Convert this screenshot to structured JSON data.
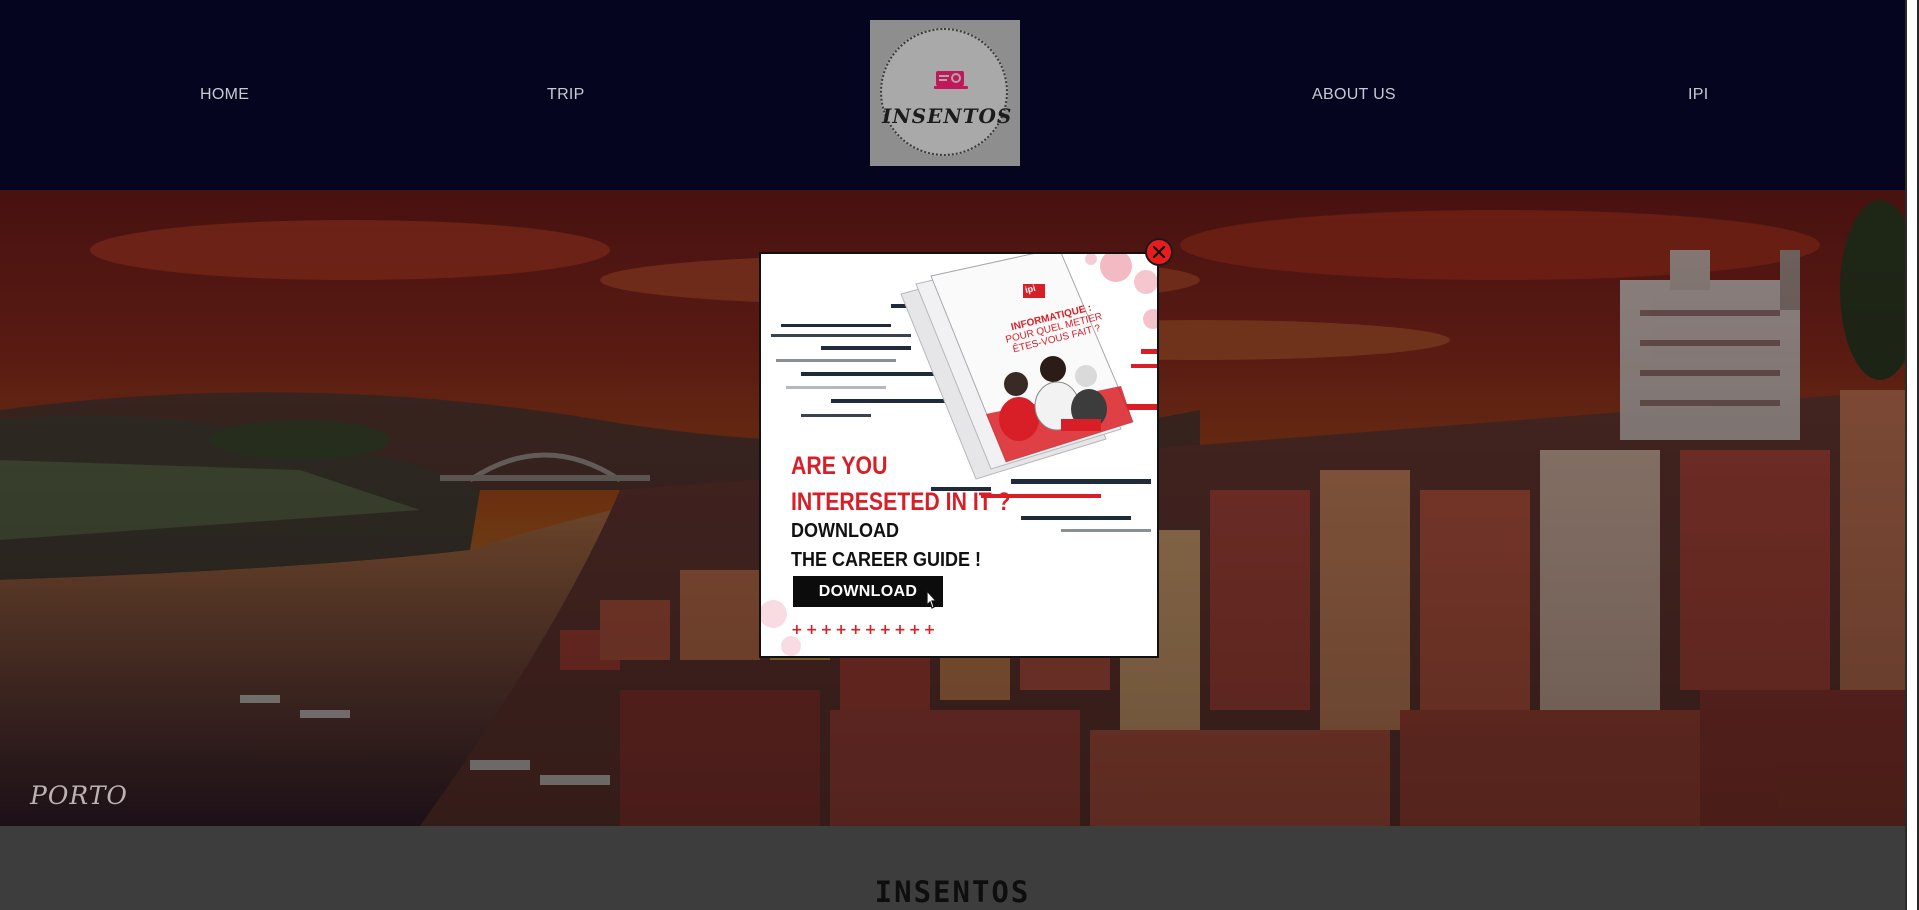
{
  "nav": {
    "home": "HOME",
    "trip": "TRIP",
    "about": "ABOUT US",
    "ipi": "IPI"
  },
  "logo": {
    "text": "INSENTOS",
    "icon": "laptop-icon"
  },
  "hero": {
    "caption": "PORTO"
  },
  "section": {
    "title": "INSENTOS"
  },
  "popup": {
    "brochure_logo": "ipi",
    "brochure_title_line1": "INFORMATIQUE :",
    "brochure_title_line2": "POUR QUEL METIER",
    "brochure_title_line3": "ÊTES-VOUS FAIT ?",
    "headline_line1": "ARE YOU",
    "headline_line2": "INTERESETED IN IT ?",
    "subline1": "DOWNLOAD",
    "subline2": "THE CAREER GUIDE !",
    "button_label": "DOWNLOAD",
    "plus_row": "++++++++++",
    "close_icon": "close-icon"
  },
  "colors": {
    "header_bg": "#06051f",
    "accent_red": "#d81e26",
    "close_red": "#e81c1c"
  }
}
